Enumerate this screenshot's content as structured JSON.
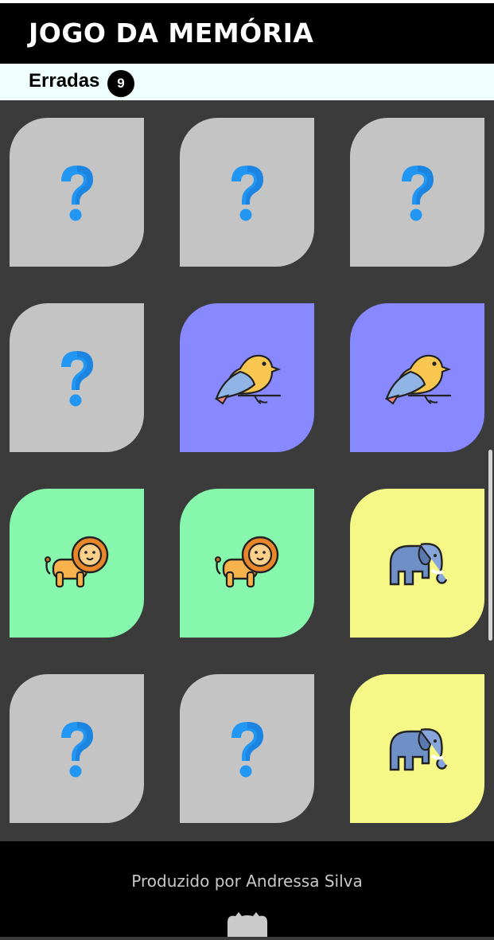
{
  "header": {
    "title": "JOGO DA MEMÓRIA"
  },
  "status": {
    "errors_label": "Erradas",
    "errors_count": "9"
  },
  "colors": {
    "hidden": "#c4c4c4",
    "bird": "#8888ff",
    "lion": "#86f7ac",
    "elephant": "#f5f887",
    "question": "#2196f3"
  },
  "cards": [
    {
      "state": "hidden",
      "icon": "question-icon"
    },
    {
      "state": "hidden",
      "icon": "question-icon"
    },
    {
      "state": "hidden",
      "icon": "question-icon"
    },
    {
      "state": "hidden",
      "icon": "question-icon"
    },
    {
      "state": "revealed",
      "icon": "bird-icon"
    },
    {
      "state": "revealed",
      "icon": "bird-icon"
    },
    {
      "state": "revealed",
      "icon": "lion-icon"
    },
    {
      "state": "revealed",
      "icon": "lion-icon"
    },
    {
      "state": "revealed",
      "icon": "elephant-icon"
    },
    {
      "state": "hidden",
      "icon": "question-icon"
    },
    {
      "state": "hidden",
      "icon": "question-icon"
    },
    {
      "state": "revealed",
      "icon": "elephant-icon"
    }
  ],
  "footer": {
    "credit": "Produzido por Andressa Silva",
    "icon": "github-icon"
  }
}
